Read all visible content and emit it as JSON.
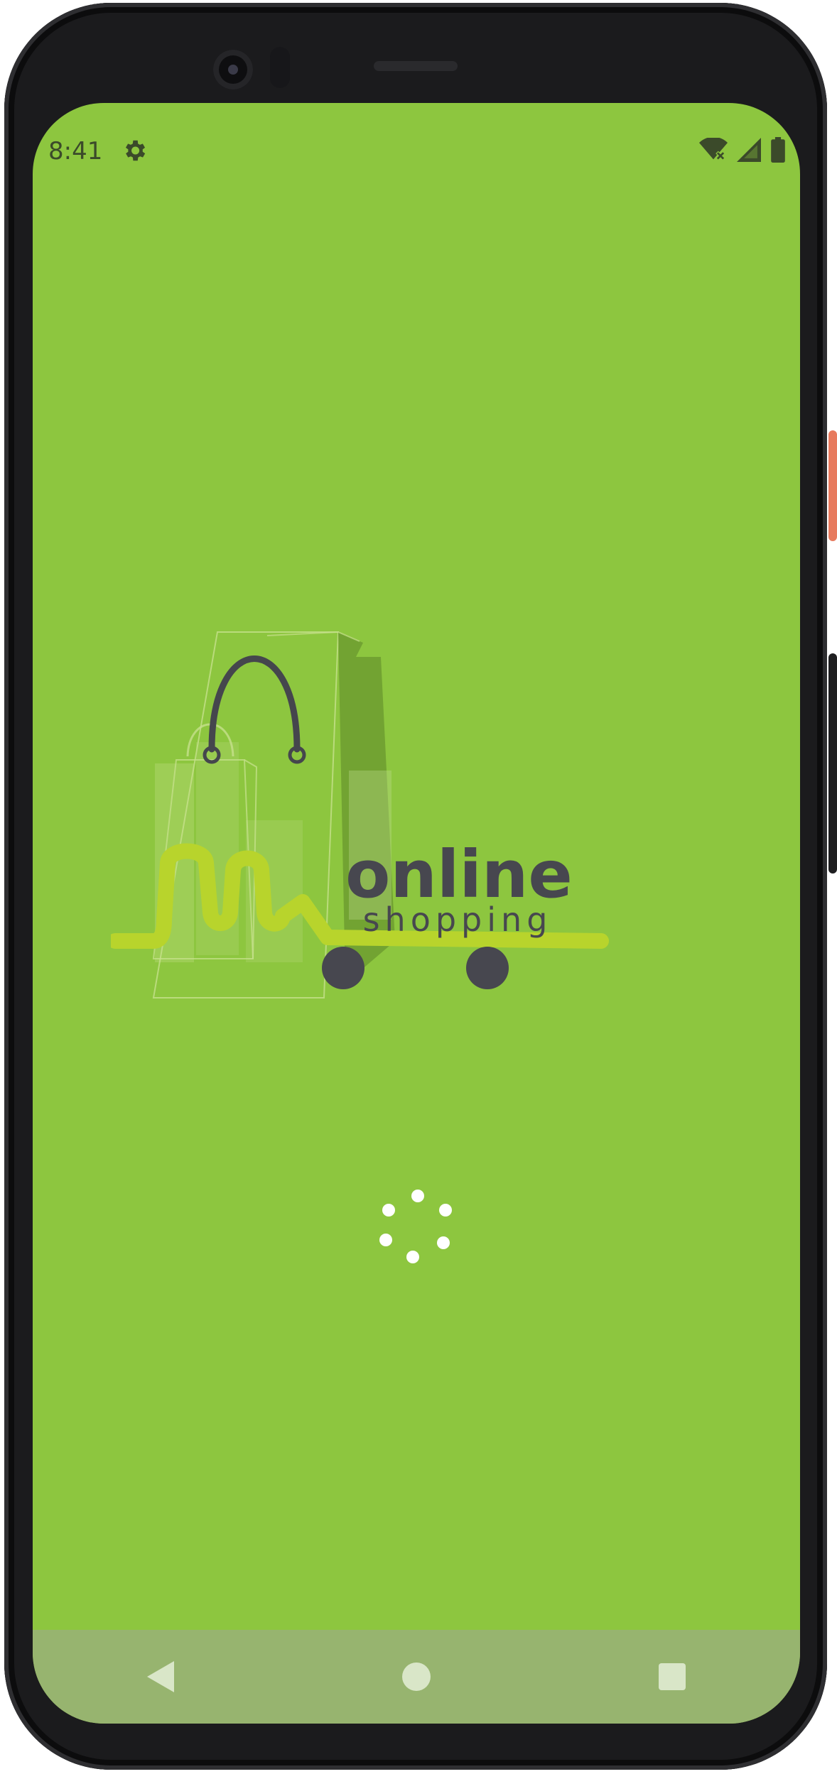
{
  "status_bar": {
    "time": "8:41",
    "settings_icon": "gear-icon",
    "wifi_icon": "wifi-no-internet-icon",
    "signal_icon": "cell-signal-icon",
    "battery_icon": "battery-full-icon"
  },
  "splash": {
    "logo_text_primary": "online",
    "logo_text_secondary": "shopping",
    "loading_indicator": "spinner-icon",
    "background_color": "#8dc63f",
    "logo_dark_color": "#47474f",
    "logo_accent_color": "#b8d42c"
  },
  "nav_bar": {
    "back_icon": "back-triangle-icon",
    "home_icon": "home-circle-icon",
    "recents_icon": "recents-square-icon"
  }
}
